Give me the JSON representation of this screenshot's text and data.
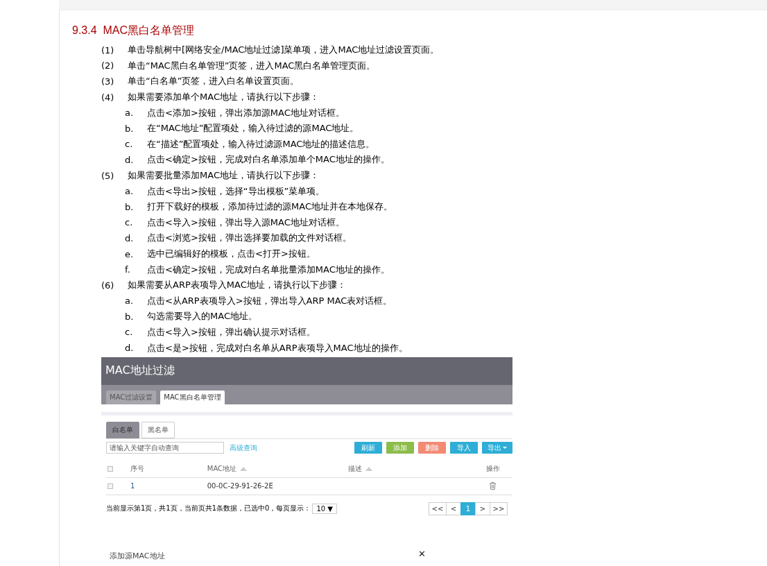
{
  "heading": {
    "number": "9.3.4",
    "title": "MAC黑白名单管理"
  },
  "steps": [
    {
      "number": "(1)",
      "text": "单击导航树中[网络安全/MAC地址过滤]菜单项，进入MAC地址过滤设置页面。"
    },
    {
      "number": "(2)",
      "text": "单击“MAC黑白名单管理”页签，进入MAC黑白名单管理页面。"
    },
    {
      "number": "(3)",
      "text": "单击“白名单”页签，进入白名单设置页面。"
    },
    {
      "number": "(4)",
      "text": "如果需要添加单个MAC地址，请执行以下步骤：",
      "substeps": [
        {
          "letter": "a.",
          "text": "点击<添加>按钮，弹出添加源MAC地址对话框。"
        },
        {
          "letter": "b.",
          "text": "在“MAC地址”配置项处，输入待过滤的源MAC地址。"
        },
        {
          "letter": "c.",
          "text": "在“描述”配置项处，输入待过滤源MAC地址的描述信息。"
        },
        {
          "letter": "d.",
          "text": "点击<确定>按钮，完成对白名单添加单个MAC地址的操作。"
        }
      ]
    },
    {
      "number": "(5)",
      "text": "如果需要批量添加MAC地址，请执行以下步骤：",
      "substeps": [
        {
          "letter": "a.",
          "text": "点击<导出>按钮，选择“导出模板”菜单项。"
        },
        {
          "letter": "b.",
          "text": "打开下载好的模板，添加待过滤的源MAC地址并在本地保存。"
        },
        {
          "letter": "c.",
          "text": "点击<导入>按钮，弹出导入源MAC地址对话框。"
        },
        {
          "letter": "d.",
          "text": "点击<浏览>按钮，弹出选择要加载的文件对话框。"
        },
        {
          "letter": "e.",
          "text": "选中已编辑好的模板，点击<打开>按钮。"
        },
        {
          "letter": "f.",
          "text": "点击<确定>按钮，完成对白名单批量添加MAC地址的操作。"
        }
      ]
    },
    {
      "number": "(6)",
      "text": "如果需要从ARP表项导入MAC地址，请执行以下步骤：",
      "substeps": [
        {
          "letter": "a.",
          "text": "点击<从ARP表项导入>按钮，弹出导入ARP MAC表对话框。"
        },
        {
          "letter": "b.",
          "text": "勾选需要导入的MAC地址。"
        },
        {
          "letter": "c.",
          "text": "点击<导入>按钮，弹出确认提示对话框。"
        },
        {
          "letter": "d.",
          "text": "点击<是>按钮，完成对白名单从ARP表项导入MAC地址的操作。"
        }
      ]
    }
  ],
  "app": {
    "title": "MAC地址过滤",
    "tabs": [
      {
        "label": "MAC过滤设置",
        "selected": false
      },
      {
        "label": "MAC黑白名单管理",
        "selected": true
      }
    ],
    "sub_tabs": [
      {
        "label": "白名单",
        "selected": true
      },
      {
        "label": "黑名单",
        "selected": false
      }
    ],
    "search": {
      "placeholder": "请输入关键字自动查询"
    },
    "advanced_link": "高级查询",
    "buttons": [
      {
        "label": "刷新",
        "color": "#2eaed6",
        "dropdown": false
      },
      {
        "label": "添加",
        "color": "#8cbd4a",
        "dropdown": false
      },
      {
        "label": "删除",
        "color": "#f28a74",
        "dropdown": false
      },
      {
        "label": "导入",
        "color": "#2eaed6",
        "dropdown": false
      },
      {
        "label": "导出",
        "color": "#2eaed6",
        "dropdown": true
      }
    ],
    "table": {
      "select_all": false,
      "columns": [
        {
          "label": "序号",
          "sortable": false
        },
        {
          "label": "MAC地址",
          "sortable": true
        },
        {
          "label": "描述",
          "sortable": true
        },
        {
          "label": "操作",
          "sortable": false
        }
      ],
      "rows": [
        {
          "checked": false,
          "index": "1",
          "mac": "00-0C-29-91-26-2E"
        }
      ]
    },
    "page_info": "当前显示第1页，共1页，当前页共1条数据，已选中0，每页显示：",
    "page_size": "10 ▼",
    "pager": [
      {
        "label": "<<",
        "selected": false
      },
      {
        "label": "<",
        "selected": false
      },
      {
        "label": "1",
        "selected": true
      },
      {
        "label": ">",
        "selected": false
      },
      {
        "label": ">>",
        "selected": false
      }
    ],
    "dialog": {
      "title": "添加源MAC地址",
      "close": "✕"
    }
  }
}
